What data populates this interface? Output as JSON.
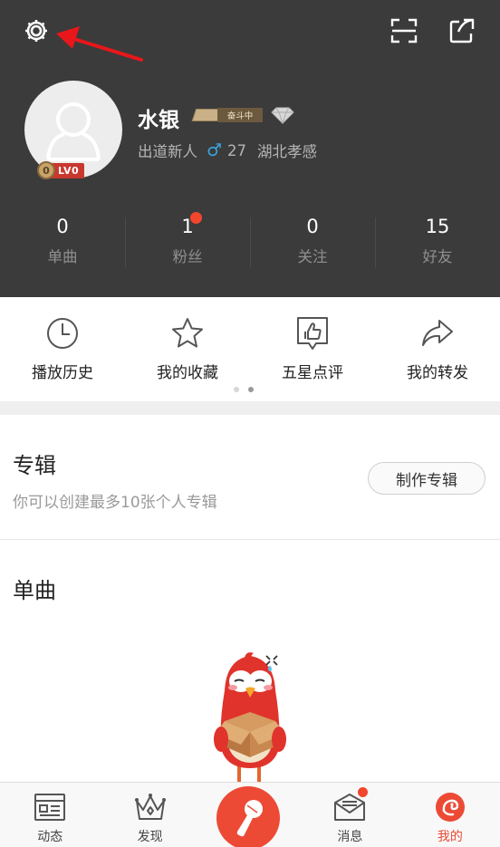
{
  "profile": {
    "username": "水银",
    "badge_text": "奋斗中",
    "title": "出道新人",
    "gender_symbol": "♂",
    "age": "27",
    "location": "湖北孝感",
    "level_coin": "0",
    "level_tag": "LV0"
  },
  "stats": [
    {
      "value": "0",
      "label": "单曲"
    },
    {
      "value": "1",
      "label": "粉丝",
      "has_dot": true
    },
    {
      "value": "0",
      "label": "关注"
    },
    {
      "value": "15",
      "label": "好友"
    }
  ],
  "quick_actions": [
    {
      "label": "播放历史",
      "icon": "clock-icon"
    },
    {
      "label": "我的收藏",
      "icon": "star-icon"
    },
    {
      "label": "五星点评",
      "icon": "thumbs-up-icon"
    },
    {
      "label": "我的转发",
      "icon": "forward-arrow-icon"
    }
  ],
  "albums": {
    "title": "专辑",
    "desc": "你可以创建最多10张个人专辑",
    "button": "制作专辑"
  },
  "singles": {
    "title": "单曲"
  },
  "tabs": [
    {
      "label": "动态",
      "icon": "feed-icon"
    },
    {
      "label": "发现",
      "icon": "crown-icon"
    },
    {
      "label": "消息",
      "icon": "mail-icon",
      "has_dot": true
    },
    {
      "label": "我的",
      "icon": "bird-logo-icon",
      "active": true
    }
  ],
  "colors": {
    "header_bg": "#3b3b3b",
    "accent": "#ec4a35",
    "notification_dot": "#f2462e",
    "male_blue": "#39a5de"
  }
}
